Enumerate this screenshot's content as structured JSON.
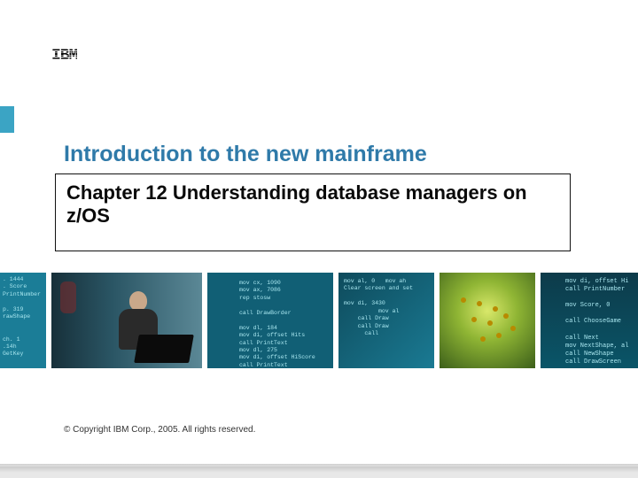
{
  "logo_text": "IBM",
  "title": "Introduction to the new mainframe",
  "chapter": "Chapter 12 Understanding database managers on z/OS",
  "copyright": "© Copyright IBM Corp., 2005. All rights reserved.",
  "code_snippets": {
    "tile1": ". 1444\n. Score\nPrintNumber\n\np. 319\nrawShape\n\n\nch. 1\n.14h\nGetKey",
    "tile3": "mov cx, 1090\nmov ax, 7086\nrep stosw\n\ncall DrawBorder\n\nmov dl, 184\nmov di, offset Hits\ncall PrintText\nmov dl, 275\nmov di, offset HiScore\ncall PrintText",
    "tile4": "mov al, 0   mov ah\nClear screen and set\n\nmov di, 3430\n          mov al\n    call Draw\n    call Draw\n      call   ",
    "tile6": "mov di, offset Hi\ncall PrintNumber\n\nmov Score, 0\n\ncall ChooseGame\n\ncall Next\nmov NextShape, al\ncall NewShape\ncall DrawScreen"
  }
}
